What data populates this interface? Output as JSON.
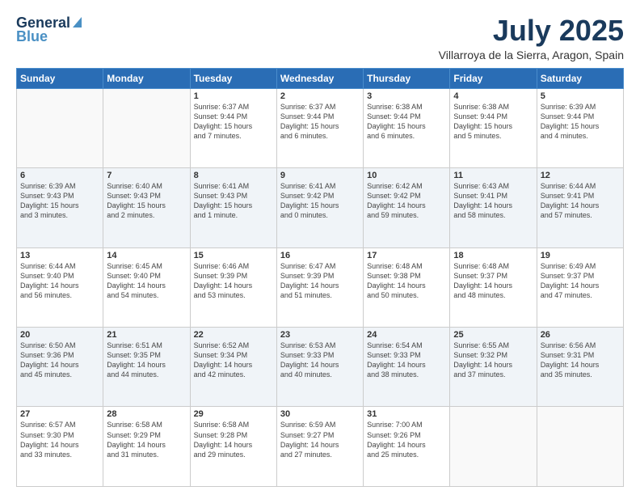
{
  "logo": {
    "line1": "General",
    "line2": "Blue"
  },
  "header": {
    "month": "July 2025",
    "location": "Villarroya de la Sierra, Aragon, Spain"
  },
  "weekdays": [
    "Sunday",
    "Monday",
    "Tuesday",
    "Wednesday",
    "Thursday",
    "Friday",
    "Saturday"
  ],
  "weeks": [
    [
      {
        "day": "",
        "info": ""
      },
      {
        "day": "",
        "info": ""
      },
      {
        "day": "1",
        "info": "Sunrise: 6:37 AM\nSunset: 9:44 PM\nDaylight: 15 hours\nand 7 minutes."
      },
      {
        "day": "2",
        "info": "Sunrise: 6:37 AM\nSunset: 9:44 PM\nDaylight: 15 hours\nand 6 minutes."
      },
      {
        "day": "3",
        "info": "Sunrise: 6:38 AM\nSunset: 9:44 PM\nDaylight: 15 hours\nand 6 minutes."
      },
      {
        "day": "4",
        "info": "Sunrise: 6:38 AM\nSunset: 9:44 PM\nDaylight: 15 hours\nand 5 minutes."
      },
      {
        "day": "5",
        "info": "Sunrise: 6:39 AM\nSunset: 9:44 PM\nDaylight: 15 hours\nand 4 minutes."
      }
    ],
    [
      {
        "day": "6",
        "info": "Sunrise: 6:39 AM\nSunset: 9:43 PM\nDaylight: 15 hours\nand 3 minutes."
      },
      {
        "day": "7",
        "info": "Sunrise: 6:40 AM\nSunset: 9:43 PM\nDaylight: 15 hours\nand 2 minutes."
      },
      {
        "day": "8",
        "info": "Sunrise: 6:41 AM\nSunset: 9:43 PM\nDaylight: 15 hours\nand 1 minute."
      },
      {
        "day": "9",
        "info": "Sunrise: 6:41 AM\nSunset: 9:42 PM\nDaylight: 15 hours\nand 0 minutes."
      },
      {
        "day": "10",
        "info": "Sunrise: 6:42 AM\nSunset: 9:42 PM\nDaylight: 14 hours\nand 59 minutes."
      },
      {
        "day": "11",
        "info": "Sunrise: 6:43 AM\nSunset: 9:41 PM\nDaylight: 14 hours\nand 58 minutes."
      },
      {
        "day": "12",
        "info": "Sunrise: 6:44 AM\nSunset: 9:41 PM\nDaylight: 14 hours\nand 57 minutes."
      }
    ],
    [
      {
        "day": "13",
        "info": "Sunrise: 6:44 AM\nSunset: 9:40 PM\nDaylight: 14 hours\nand 56 minutes."
      },
      {
        "day": "14",
        "info": "Sunrise: 6:45 AM\nSunset: 9:40 PM\nDaylight: 14 hours\nand 54 minutes."
      },
      {
        "day": "15",
        "info": "Sunrise: 6:46 AM\nSunset: 9:39 PM\nDaylight: 14 hours\nand 53 minutes."
      },
      {
        "day": "16",
        "info": "Sunrise: 6:47 AM\nSunset: 9:39 PM\nDaylight: 14 hours\nand 51 minutes."
      },
      {
        "day": "17",
        "info": "Sunrise: 6:48 AM\nSunset: 9:38 PM\nDaylight: 14 hours\nand 50 minutes."
      },
      {
        "day": "18",
        "info": "Sunrise: 6:48 AM\nSunset: 9:37 PM\nDaylight: 14 hours\nand 48 minutes."
      },
      {
        "day": "19",
        "info": "Sunrise: 6:49 AM\nSunset: 9:37 PM\nDaylight: 14 hours\nand 47 minutes."
      }
    ],
    [
      {
        "day": "20",
        "info": "Sunrise: 6:50 AM\nSunset: 9:36 PM\nDaylight: 14 hours\nand 45 minutes."
      },
      {
        "day": "21",
        "info": "Sunrise: 6:51 AM\nSunset: 9:35 PM\nDaylight: 14 hours\nand 44 minutes."
      },
      {
        "day": "22",
        "info": "Sunrise: 6:52 AM\nSunset: 9:34 PM\nDaylight: 14 hours\nand 42 minutes."
      },
      {
        "day": "23",
        "info": "Sunrise: 6:53 AM\nSunset: 9:33 PM\nDaylight: 14 hours\nand 40 minutes."
      },
      {
        "day": "24",
        "info": "Sunrise: 6:54 AM\nSunset: 9:33 PM\nDaylight: 14 hours\nand 38 minutes."
      },
      {
        "day": "25",
        "info": "Sunrise: 6:55 AM\nSunset: 9:32 PM\nDaylight: 14 hours\nand 37 minutes."
      },
      {
        "day": "26",
        "info": "Sunrise: 6:56 AM\nSunset: 9:31 PM\nDaylight: 14 hours\nand 35 minutes."
      }
    ],
    [
      {
        "day": "27",
        "info": "Sunrise: 6:57 AM\nSunset: 9:30 PM\nDaylight: 14 hours\nand 33 minutes."
      },
      {
        "day": "28",
        "info": "Sunrise: 6:58 AM\nSunset: 9:29 PM\nDaylight: 14 hours\nand 31 minutes."
      },
      {
        "day": "29",
        "info": "Sunrise: 6:58 AM\nSunset: 9:28 PM\nDaylight: 14 hours\nand 29 minutes."
      },
      {
        "day": "30",
        "info": "Sunrise: 6:59 AM\nSunset: 9:27 PM\nDaylight: 14 hours\nand 27 minutes."
      },
      {
        "day": "31",
        "info": "Sunrise: 7:00 AM\nSunset: 9:26 PM\nDaylight: 14 hours\nand 25 minutes."
      },
      {
        "day": "",
        "info": ""
      },
      {
        "day": "",
        "info": ""
      }
    ]
  ]
}
